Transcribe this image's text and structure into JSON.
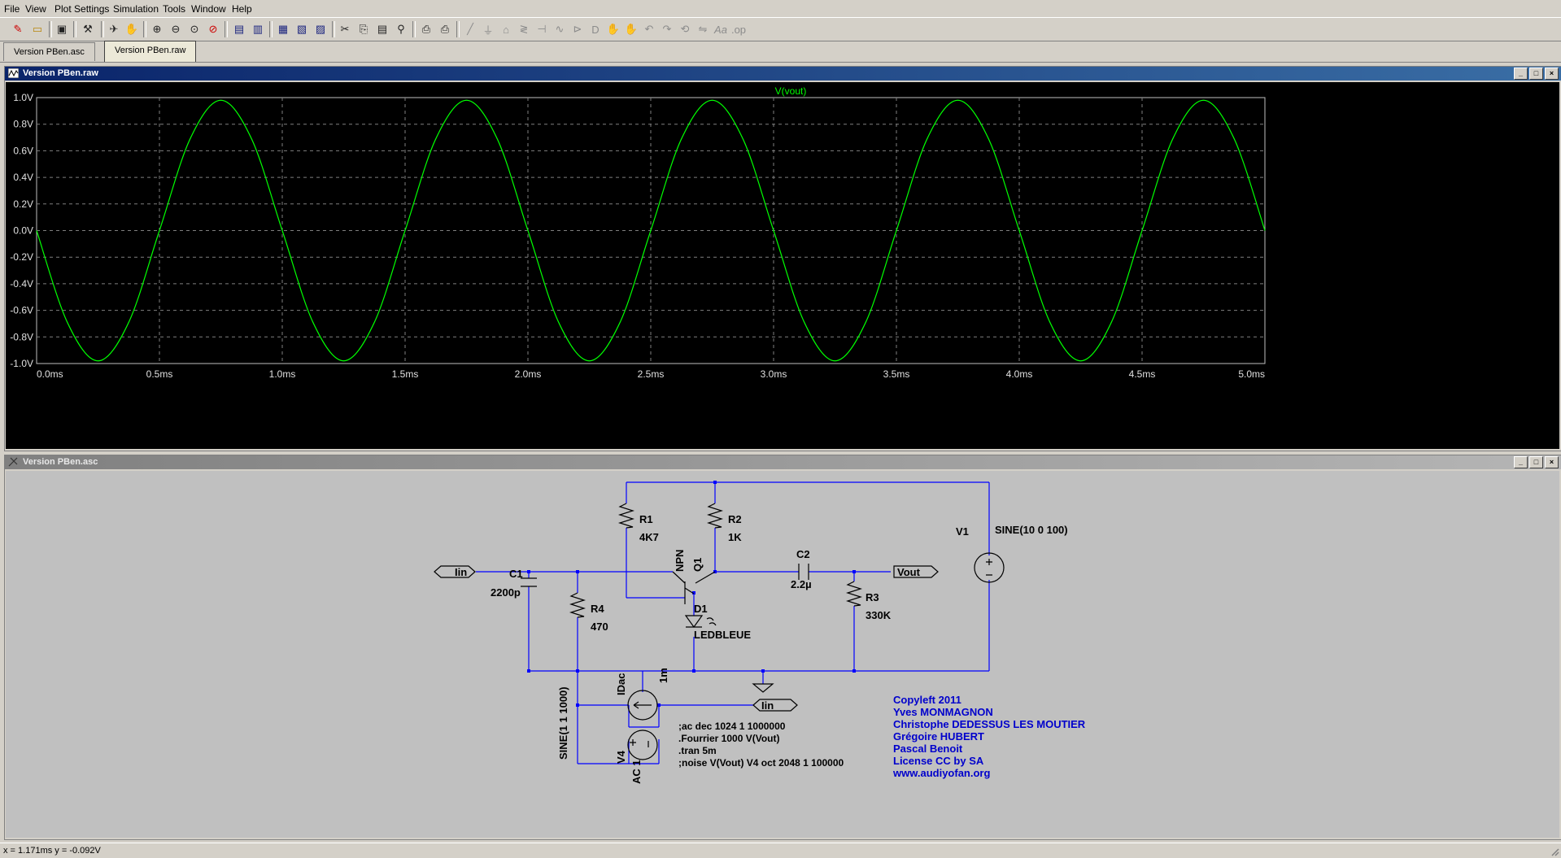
{
  "menu": [
    "File",
    "View",
    "Plot Settings",
    "Simulation",
    "Tools",
    "Window",
    "Help"
  ],
  "tabs": [
    "Version PBen.asc",
    "Version PBen.raw"
  ],
  "toolbar_icons": [
    "new-schematic-icon",
    "open-icon",
    "save-icon",
    "control-panel-icon",
    "run-icon",
    "halt-icon",
    "zoom-in-icon",
    "zoom-out-icon",
    "zoom-full-icon",
    "zoom-cancel-icon",
    "autorange-icon",
    "add-trace-icon",
    "tile-horizontal-icon",
    "tile-vertical-icon",
    "cascade-icon",
    "cut-icon",
    "copy-icon",
    "paste-icon",
    "find-icon",
    "print-preview-icon",
    "print-icon",
    "wire-icon",
    "ground-icon",
    "label-net-icon",
    "resistor-icon",
    "capacitor-icon",
    "inductor-icon",
    "diode-icon",
    "component-icon",
    "move-icon",
    "drag-icon",
    "undo-icon",
    "redo-icon",
    "rotate-icon",
    "mirror-icon",
    "text-icon",
    "spice-directive-icon"
  ],
  "plot_window": {
    "title": "Version PBen.raw",
    "trace_label": "V(vout)",
    "trace_color": "#00ff00"
  },
  "chart_data": {
    "type": "line",
    "title": "V(vout)",
    "x_unit": "ms",
    "y_unit": "V",
    "xlim": [
      0.0,
      5.0
    ],
    "ylim": [
      -1.0,
      1.0
    ],
    "grid": true,
    "x_ticks": [
      "0.0ms",
      "0.5ms",
      "1.0ms",
      "1.5ms",
      "2.0ms",
      "2.5ms",
      "3.0ms",
      "3.5ms",
      "4.0ms",
      "4.5ms",
      "5.0ms"
    ],
    "y_ticks": [
      "1.0V",
      "0.8V",
      "0.6V",
      "0.4V",
      "0.2V",
      "0.0V",
      "-0.2V",
      "-0.4V",
      "-0.6V",
      "-0.8V",
      "-1.0V"
    ],
    "series": [
      {
        "name": "V(vout)",
        "x": [
          0.0,
          0.125,
          0.25,
          0.375,
          0.5,
          0.625,
          0.75,
          0.875,
          1.0,
          1.125,
          1.25,
          1.375,
          1.5,
          1.625,
          1.75,
          1.875,
          2.0,
          2.125,
          2.25,
          2.375,
          2.5,
          2.625,
          2.75,
          2.875,
          3.0,
          3.125,
          3.25,
          3.375,
          3.5,
          3.625,
          3.75,
          3.875,
          4.0,
          4.125,
          4.25,
          4.375,
          4.5,
          4.625,
          4.75,
          4.875,
          5.0
        ],
        "y": [
          0.0,
          -0.69,
          -0.98,
          -0.69,
          0.0,
          0.69,
          0.98,
          0.69,
          0.0,
          -0.69,
          -0.98,
          -0.69,
          0.0,
          0.69,
          0.98,
          0.69,
          0.0,
          -0.69,
          -0.98,
          -0.69,
          0.0,
          0.69,
          0.98,
          0.69,
          0.0,
          -0.69,
          -0.98,
          -0.69,
          0.0,
          0.69,
          0.98,
          0.69,
          0.0,
          -0.69,
          -0.98,
          -0.69,
          0.0,
          0.69,
          0.98,
          0.69,
          0.0
        ]
      }
    ]
  },
  "schematic_window": {
    "title": "Version PBen.asc",
    "labels": {
      "r1": "R1",
      "r1_val": "4K7",
      "r2": "R2",
      "r2_val": "1K",
      "r3": "R3",
      "r3_val": "330K",
      "r4": "R4",
      "r4_val": "470",
      "c1": "C1",
      "c1_val": "2200p",
      "c2": "C2",
      "c2_val": "2.2µ",
      "q1": "Q1",
      "q1_type": "NPN",
      "d1": "D1",
      "d1_val": "LEDBLEUE",
      "v1": "V1",
      "v1_val": "SINE(10 0 100)",
      "v4": "V4",
      "v4_val": "SINE(1 1 1000)",
      "v4_ac": "AC 1",
      "i_src": "IDac",
      "i_val": "1m",
      "net_iin": "Iin",
      "net_iin2": "Iin",
      "net_vout": "Vout"
    },
    "directives": [
      ";ac dec 1024 1 1000000",
      ".Fourrier 1000 V(Vout)",
      ".tran 5m",
      ";noise V(Vout) V4 oct 2048 1 100000"
    ],
    "credits": [
      "Copyleft 2011",
      "Yves MONMAGNON",
      "Christophe DEDESSUS LES MOUTIER",
      "Grégoire HUBERT",
      "Pascal Benoit",
      "License CC by SA",
      "www.audiyofan.org"
    ]
  },
  "status": "x = 1.171ms    y = -0.092V",
  "colors": {
    "plot_bg": "#000000",
    "trace": "#00ff00",
    "grid": "#7f7f7f",
    "schematic_bg": "#c0c0c0",
    "wire": "#0000ff",
    "component": "#000000",
    "comment": "#0000cc",
    "title_active": "#0a246a"
  }
}
